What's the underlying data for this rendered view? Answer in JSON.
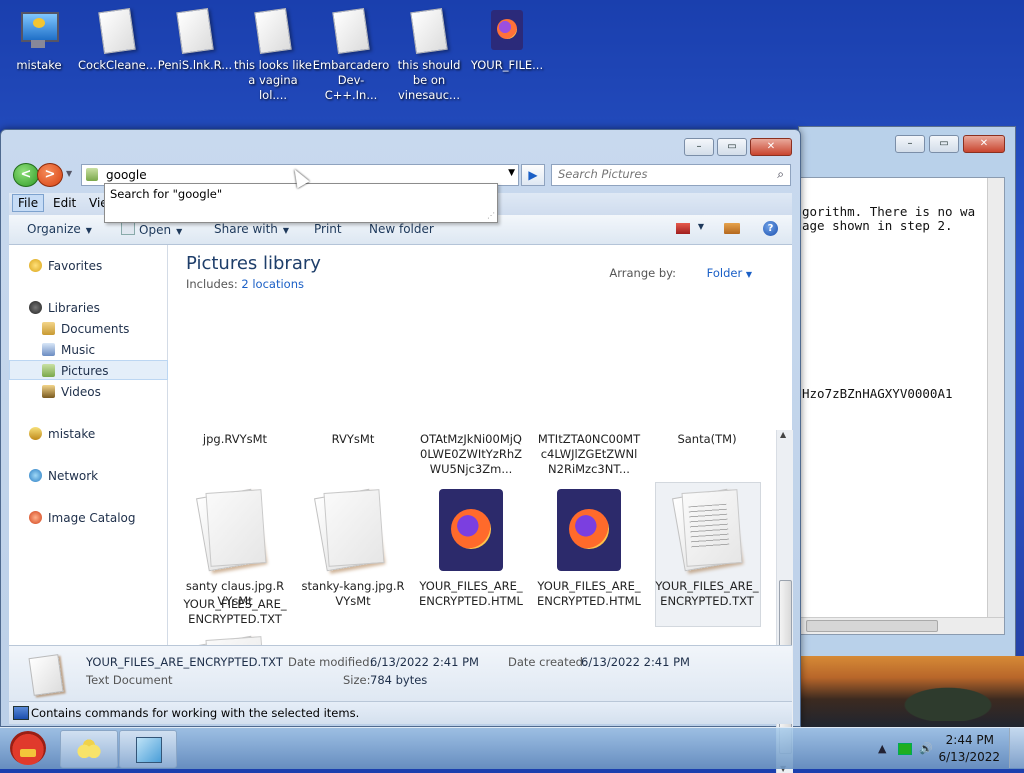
{
  "desktop": {
    "icons": [
      {
        "label": "mistake",
        "kind": "computer-icon"
      },
      {
        "label": "CockCleane...",
        "kind": "document-icon"
      },
      {
        "label": "PeniS.lnk.R...",
        "kind": "document-icon"
      },
      {
        "label": "this looks like a vagina lol....",
        "kind": "document-icon"
      },
      {
        "label": "Embarcadero Dev-C++.In...",
        "kind": "document-icon"
      },
      {
        "label": "this should be on vinesauc...",
        "kind": "document-icon"
      },
      {
        "label": "YOUR_FILE...",
        "kind": "firefox-html-icon"
      }
    ]
  },
  "back_window": {
    "buttons": {
      "minimize": "–",
      "maximize": "▭",
      "close": "✕"
    },
    "lines": [
      {
        "text": "gorithm. There is no wa"
      },
      {
        "text": "age shown in step 2."
      },
      {
        "text": "Hzo7zBZnHAGXYV0000A1"
      }
    ]
  },
  "explorer": {
    "buttons": {
      "minimize": "–",
      "maximize": "▭",
      "close": "✕"
    },
    "nav": {
      "back": "<",
      "forward": ">",
      "go": "▶"
    },
    "address_value": "google",
    "search_placeholder": "Search Pictures",
    "suggestion": "Search for \"google\"",
    "menu": {
      "file": "File",
      "edit": "Edit",
      "view": "Vie"
    },
    "toolbar": {
      "organize": "Organize",
      "open": "Open",
      "share_with": "Share with",
      "print": "Print",
      "new_folder": "New folder",
      "help": "?"
    },
    "nav_pane": {
      "favorites": "Favorites",
      "libraries": "Libraries",
      "documents": "Documents",
      "music": "Music",
      "pictures": "Pictures",
      "videos": "Videos",
      "homegroup": "mistake",
      "network": "Network",
      "image_catalog": "Image Catalog"
    },
    "library": {
      "title": "Pictures library",
      "includes_label": "Includes:",
      "includes_link": "2 locations",
      "arrange_label": "Arrange by:",
      "arrange_value": "Folder"
    },
    "files": [
      {
        "name": "jpg.RVYsMt",
        "type": "partial"
      },
      {
        "name": "RVYsMt",
        "type": "partial"
      },
      {
        "name": "OTAtMzJkNi00MjQ0LWE0ZWItYzRhZWU5Njc3Zm...",
        "type": "partial"
      },
      {
        "name": "MTItZTA0NC00MTc4LWJlZGEtZWNlN2RiMzc3NT...",
        "type": "partial"
      },
      {
        "name": "Santa(TM)",
        "type": "partial"
      },
      {
        "name": "santy claus.jpg.RVYsMt",
        "type": "doc"
      },
      {
        "name": "stanky-kang.jpg.RVYsMt",
        "type": "doc"
      },
      {
        "name": "YOUR_FILES_ARE_ENCRYPTED.HTML",
        "type": "firefox"
      },
      {
        "name": "YOUR_FILES_ARE_ENCRYPTED.HTML",
        "type": "firefox"
      },
      {
        "name": "YOUR_FILES_ARE_ENCRYPTED.TXT",
        "type": "txt",
        "selected": true
      },
      {
        "name": "YOUR_FILES_ARE_ENCRYPTED.TXT",
        "type": "txt"
      }
    ],
    "details": {
      "file_name": "YOUR_FILES_ARE_ENCRYPTED.TXT",
      "file_type": "Text Document",
      "modified_label": "Date modified:",
      "modified_value": "6/13/2022 2:41 PM",
      "created_label": "Date created:",
      "created_value": "6/13/2022 2:41 PM",
      "size_label": "Size:",
      "size_value": "784 bytes"
    },
    "status": "Contains commands for working with the selected items."
  },
  "taskbar": {
    "time": "2:44 PM",
    "date": "6/13/2022",
    "tray_arrow": "▲"
  }
}
